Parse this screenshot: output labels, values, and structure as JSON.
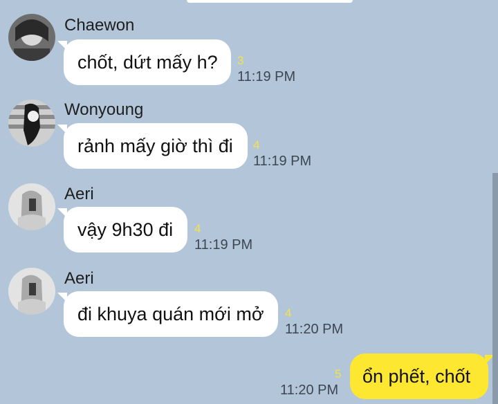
{
  "messages": [
    {
      "sender": "Chaewon",
      "text": "chốt, dứt mấy h?",
      "unread": "3",
      "time": "11:19 PM",
      "avatar": "avatar-chaewon"
    },
    {
      "sender": "Wonyoung",
      "text": "rảnh mấy giờ thì đi",
      "unread": "4",
      "time": "11:19 PM",
      "avatar": "avatar-wonyoung"
    },
    {
      "sender": "Aeri",
      "text": "vậy 9h30 đi",
      "unread": "4",
      "time": "11:19 PM",
      "avatar": "avatar-aeri"
    },
    {
      "sender": "Aeri",
      "text": "đi khuya quán mới mở",
      "unread": "4",
      "time": "11:20 PM",
      "avatar": "avatar-aeri"
    }
  ],
  "outgoing": {
    "text": "ổn phết, chốt",
    "unread": "5",
    "time": "11:20 PM"
  },
  "colors": {
    "background": "#b3c6d9",
    "incoming_bubble": "#ffffff",
    "outgoing_bubble": "#fde731",
    "unread_count": "#f4e24a"
  }
}
